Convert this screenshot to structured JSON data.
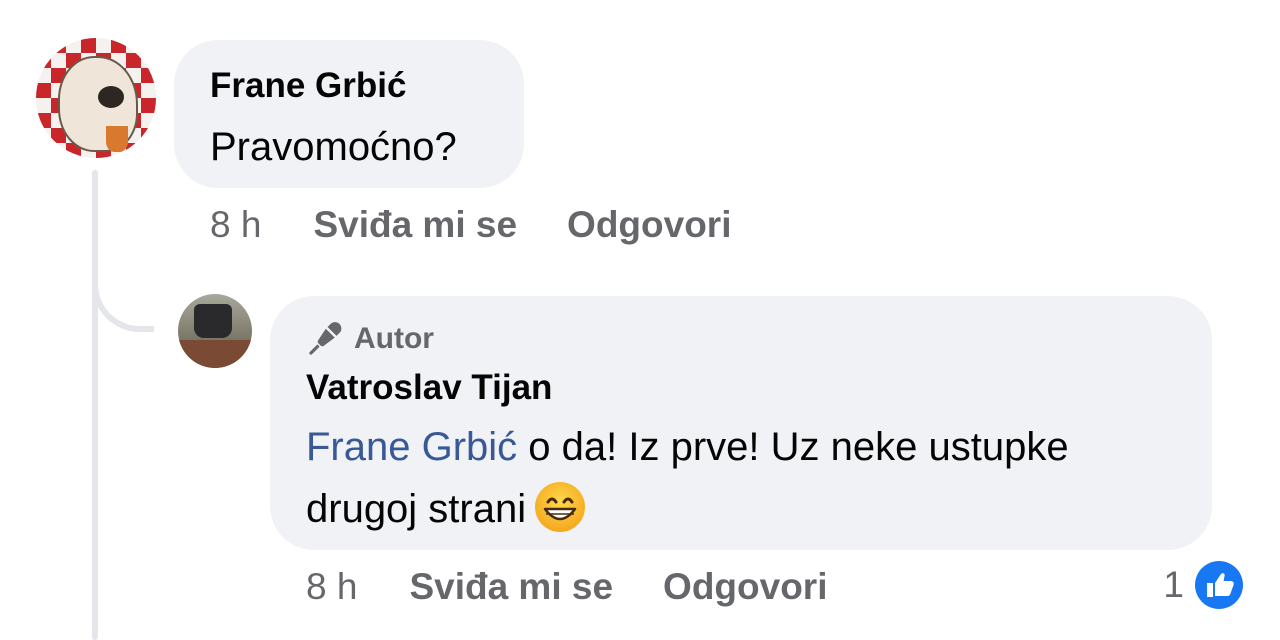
{
  "comment": {
    "author": "Frane Grbić",
    "text": "Pravomoćno?",
    "time": "8 h",
    "like_label": "Sviđa mi se",
    "reply_label": "Odgovori"
  },
  "reply": {
    "badge": "Autor",
    "author": "Vatroslav Tijan",
    "mention": "Frane Grbić",
    "text_line1": " o da! Iz prve! Uz neke ustupke",
    "text_line2": "drugoj strani",
    "emoji": "grinning-face-emoji",
    "time": "8 h",
    "like_label": "Sviđa mi se",
    "reply_label": "Odgovori",
    "reaction_count": "1",
    "reaction_icon": "like-icon"
  },
  "colors": {
    "bubble": "#f0f2f5",
    "mention": "#385898",
    "secondary_text": "#65676b",
    "like_blue": "#1877f2"
  }
}
